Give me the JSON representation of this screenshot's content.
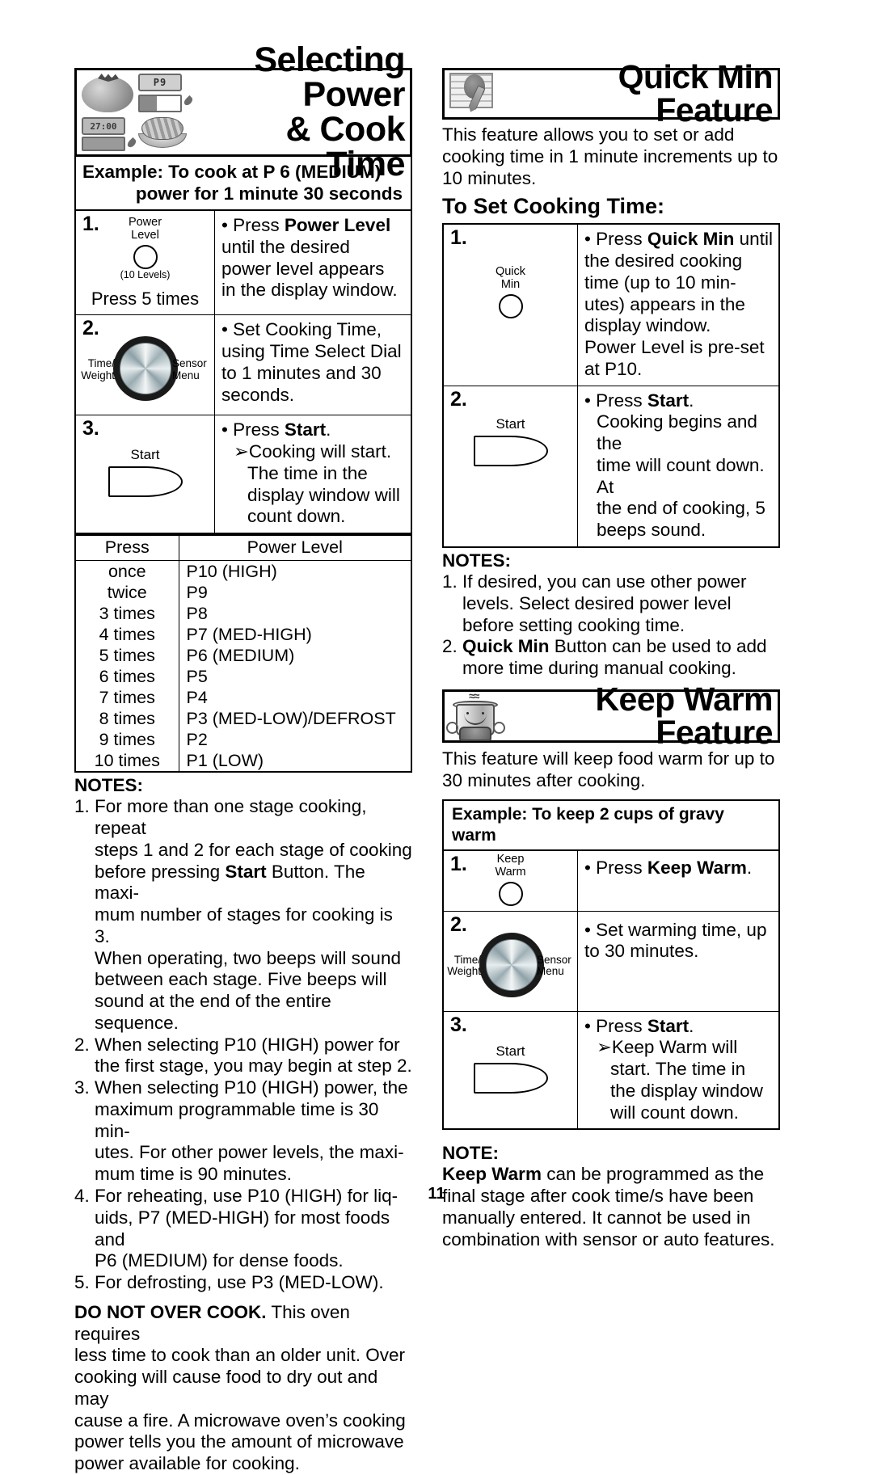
{
  "page": {
    "number": "11"
  },
  "left": {
    "banner": {
      "title_line1": "Selecting Power",
      "title_line2": "& Cook Time",
      "art": {
        "display_p": "P9",
        "display_time": "27:00"
      }
    },
    "example": {
      "line1": "Example: To cook at P 6 (MEDIUM)",
      "line2": "power for 1 minute 30 seconds"
    },
    "steps": [
      {
        "num": "1.",
        "control_label_1": "Power",
        "control_label_2": "Level",
        "control_sub": "(10 Levels)",
        "press_times": "Press 5 times",
        "lines": [
          {
            "type": "bullet",
            "html": "• Press <b>Power Level</b>"
          },
          {
            "type": "cont",
            "text": "until the desired"
          },
          {
            "type": "cont",
            "text": "power level appears"
          },
          {
            "type": "cont",
            "text": "in the display window."
          }
        ]
      },
      {
        "num": "2.",
        "dial_left_1": "Time/",
        "dial_left_2": "Weight",
        "dial_right_1": "Sensor",
        "dial_right_2": "Menu",
        "lines": [
          {
            "type": "bullet",
            "html": "• Set Cooking Time,"
          },
          {
            "type": "cont",
            "text": "using Time Select Dial"
          },
          {
            "type": "cont",
            "text": "to 1 minutes and 30"
          },
          {
            "type": "cont",
            "text": "seconds."
          }
        ]
      },
      {
        "num": "3.",
        "start_label": "Start",
        "lines": [
          {
            "type": "bullet",
            "html": "• Press <b>Start</b>."
          },
          {
            "type": "sub",
            "html": "➢Cooking will start."
          },
          {
            "type": "subcont",
            "text": "The time in the"
          },
          {
            "type": "subcont",
            "text": "display window will"
          },
          {
            "type": "subcont",
            "text": "count down."
          }
        ]
      }
    ],
    "power_table": {
      "headers": [
        "Press",
        "Power Level"
      ],
      "rows": [
        [
          "once",
          "P10 (HIGH)"
        ],
        [
          "twice",
          "P9"
        ],
        [
          "3 times",
          "P8"
        ],
        [
          "4 times",
          "P7 (MED-HIGH)"
        ],
        [
          "5 times",
          "P6 (MEDIUM)"
        ],
        [
          "6 times",
          "P5"
        ],
        [
          "7 times",
          "P4"
        ],
        [
          "8 times",
          "P3 (MED-LOW)/DEFROST"
        ],
        [
          "9 times",
          "P2"
        ],
        [
          "10 times",
          "P1 (LOW)"
        ]
      ]
    },
    "notes_title": "NOTES:",
    "notes": [
      "1. For more than one stage cooking, repeat steps 1 and 2 for each stage of cooking before pressing <b>Start</b> Button. The maxi-mum number of stages for cooking is 3. When operating, two beeps will sound between each stage. Five beeps will sound at the end of the entire sequence.",
      "2. When selecting P10 (HIGH) power for the first stage, you may begin at step 2.",
      "3. When selecting P10 (HIGH) power, the maximum programmable time is 30 min-utes. For other power levels, the maxi-mum time is 90 minutes.",
      "4. For reheating, use P10 (HIGH) for liq-uids, P7 (MED-HIGH) for most foods and P6 (MEDIUM) for dense foods.",
      "5. For defrosting, use P3 (MED-LOW)."
    ],
    "notes_lines": [
      [
        "1. For more than one stage cooking, repeat",
        "steps 1 and 2 for each stage of cooking",
        "before pressing <b>Start</b> Button. The maxi-",
        "mum number of stages for cooking is 3.",
        "When operating, two beeps will sound",
        "between each stage. Five beeps will",
        "sound at the end of the entire sequence."
      ],
      [
        "2. When selecting P10 (HIGH) power for",
        "the first stage, you may begin at step 2."
      ],
      [
        "3. When selecting P10 (HIGH) power, the",
        "maximum programmable time is 30 min-",
        "utes. For other power levels, the maxi-",
        "mum time is 90 minutes."
      ],
      [
        "4. For reheating, use P10 (HIGH) for liq-",
        "uids, P7 (MED-HIGH) for most foods and",
        "P6 (MEDIUM) for dense foods."
      ],
      [
        "5. For defrosting, use P3 (MED-LOW)."
      ]
    ],
    "warning_lines": [
      "<b>DO NOT OVER COOK.</b> This oven requires",
      "less time to cook than an older unit. Over",
      "cooking will cause food to dry out and may",
      "cause a fire. A microwave oven’s cooking",
      "power tells you the amount of microwave",
      "power available for cooking."
    ]
  },
  "right": {
    "quickmin": {
      "banner_title": "Quick Min Feature",
      "intro_lines": [
        "This feature allows you to set or add",
        "cooking time in 1 minute increments up to",
        "10 minutes."
      ],
      "sub_head": "To Set Cooking Time:",
      "steps": [
        {
          "num": "1.",
          "control_label_1": "Quick",
          "control_label_2": "Min",
          "lines": [
            {
              "type": "bullet",
              "html": "• Press <b>Quick Min</b> until"
            },
            {
              "type": "cont",
              "text": "the desired cooking"
            },
            {
              "type": "cont",
              "text": "time (up to 10 min-"
            },
            {
              "type": "cont",
              "text": "utes) appears in the"
            },
            {
              "type": "cont",
              "text": "display window."
            },
            {
              "type": "cont",
              "text": "Power Level is pre-set"
            },
            {
              "type": "cont",
              "text": "at P10."
            }
          ]
        },
        {
          "num": "2.",
          "start_label": "Start",
          "lines": [
            {
              "type": "bullet",
              "html": "• Press <b>Start</b>."
            },
            {
              "type": "cont",
              "text": "Cooking begins and the"
            },
            {
              "type": "cont",
              "text": "time will count down. At"
            },
            {
              "type": "cont",
              "text": "the end of cooking, 5"
            },
            {
              "type": "cont",
              "text": "beeps sound."
            }
          ]
        }
      ],
      "notes_title": "NOTES:",
      "notes_lines": [
        [
          "1. If desired, you can use other power",
          "levels. Select desired power level",
          "before setting cooking time."
        ],
        [
          "2. <b>Quick Min</b> Button can be used to add",
          "more time during manual cooking."
        ]
      ]
    },
    "keepwarm": {
      "banner_title": "Keep Warm Feature",
      "intro_lines": [
        "This feature will keep food warm for up to",
        "30 minutes after cooking."
      ],
      "example": "Example: To keep 2 cups of gravy warm",
      "steps": [
        {
          "num": "1.",
          "control_label_1": "Keep",
          "control_label_2": "Warm",
          "lines": [
            {
              "type": "bullet",
              "html": "• Press <b>Keep Warm</b>."
            }
          ]
        },
        {
          "num": "2.",
          "dial_left_1": "Time/",
          "dial_left_2": "Weight",
          "dial_right_1": "Sensor",
          "dial_right_2": "Menu",
          "lines": [
            {
              "type": "bullet",
              "html": "• Set warming time, up"
            },
            {
              "type": "cont",
              "text": "to 30 minutes."
            }
          ]
        },
        {
          "num": "3.",
          "start_label": "Start",
          "lines": [
            {
              "type": "bullet",
              "html": "• Press <b>Start</b>."
            },
            {
              "type": "sub",
              "html": "➢Keep Warm will"
            },
            {
              "type": "subcont",
              "text": "start. The time in"
            },
            {
              "type": "subcont",
              "text": "the display window"
            },
            {
              "type": "subcont",
              "text": "will count down."
            }
          ]
        }
      ],
      "note_title": "NOTE:",
      "note_lines": [
        "<b>Keep Warm</b> can be programmed as the",
        "final stage after cook time/s have been",
        "manually entered. It cannot be used in",
        "combination with sensor or auto features."
      ]
    }
  }
}
